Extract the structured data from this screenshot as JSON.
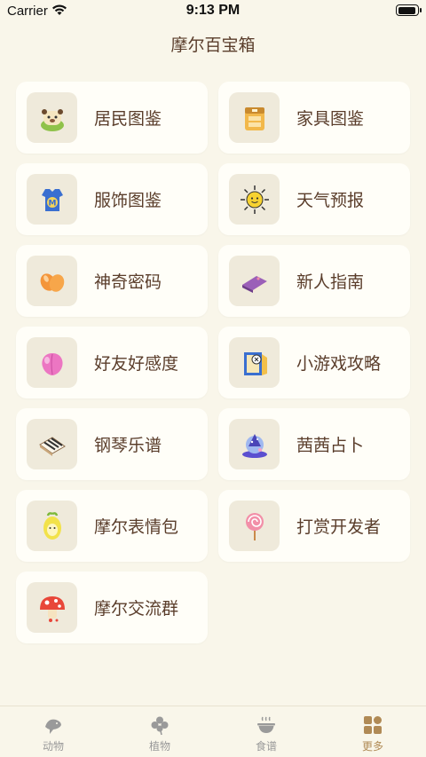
{
  "status_bar": {
    "carrier": "Carrier",
    "time": "9:13 PM"
  },
  "page": {
    "title": "摩尔百宝箱"
  },
  "items": [
    {
      "label": "居民图鉴",
      "icon": "resident-icon"
    },
    {
      "label": "家具图鉴",
      "icon": "furniture-icon"
    },
    {
      "label": "服饰图鉴",
      "icon": "clothing-icon"
    },
    {
      "label": "天气预报",
      "icon": "sun-icon"
    },
    {
      "label": "神奇密码",
      "icon": "magic-beans-icon"
    },
    {
      "label": "新人指南",
      "icon": "book-icon"
    },
    {
      "label": "好友好感度",
      "icon": "peach-icon"
    },
    {
      "label": "小游戏攻略",
      "icon": "game-icon"
    },
    {
      "label": "钢琴乐谱",
      "icon": "piano-icon"
    },
    {
      "label": "茜茜占卜",
      "icon": "crystal-ball-icon"
    },
    {
      "label": "摩尔表情包",
      "icon": "egg-icon"
    },
    {
      "label": "打赏开发者",
      "icon": "lollipop-icon"
    },
    {
      "label": "摩尔交流群",
      "icon": "mushroom-icon"
    }
  ],
  "tabs": [
    {
      "label": "动物",
      "icon": "fish-icon"
    },
    {
      "label": "植物",
      "icon": "clover-icon"
    },
    {
      "label": "食谱",
      "icon": "bowl-icon"
    },
    {
      "label": "更多",
      "icon": "more-grid-icon",
      "active": true
    }
  ],
  "colors": {
    "background": "#f9f6ea",
    "card": "#fffef8",
    "text": "#5a3d2b",
    "accent": "#b08a55"
  }
}
